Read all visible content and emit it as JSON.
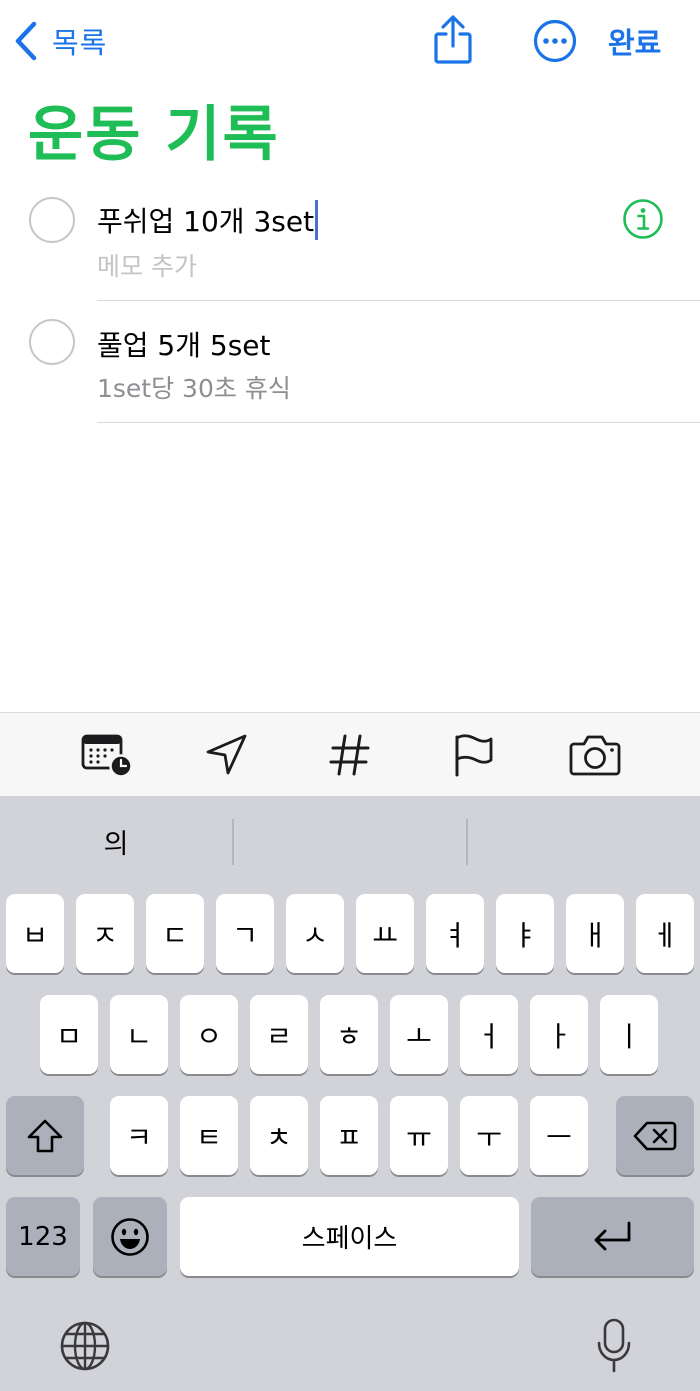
{
  "nav": {
    "back_label": "목록",
    "done_label": "완료"
  },
  "list": {
    "title": "운동 기록",
    "accent_color": "#1fbd55"
  },
  "reminders": [
    {
      "title": "푸쉬업 10개 3set",
      "note": "메모 추가",
      "editing": true
    },
    {
      "title": "풀업 5개 5set",
      "note": "1set당 30초 휴식",
      "editing": false
    }
  ],
  "toolbar": {
    "icons": [
      "calendar-clock-icon",
      "location-icon",
      "tag-hash-icon",
      "flag-icon",
      "camera-icon"
    ]
  },
  "keyboard": {
    "suggestions": [
      "의",
      "",
      ""
    ],
    "row1": [
      "ㅂ",
      "ㅈ",
      "ㄷ",
      "ㄱ",
      "ㅅ",
      "ㅛ",
      "ㅕ",
      "ㅑ",
      "ㅐ",
      "ㅔ"
    ],
    "row2": [
      "ㅁ",
      "ㄴ",
      "ㅇ",
      "ㄹ",
      "ㅎ",
      "ㅗ",
      "ㅓ",
      "ㅏ",
      "ㅣ"
    ],
    "row3": [
      "ㅋ",
      "ㅌ",
      "ㅊ",
      "ㅍ",
      "ㅠ",
      "ㅜ",
      "ㅡ"
    ],
    "numbers_label": "123",
    "space_label": "스페이스"
  }
}
